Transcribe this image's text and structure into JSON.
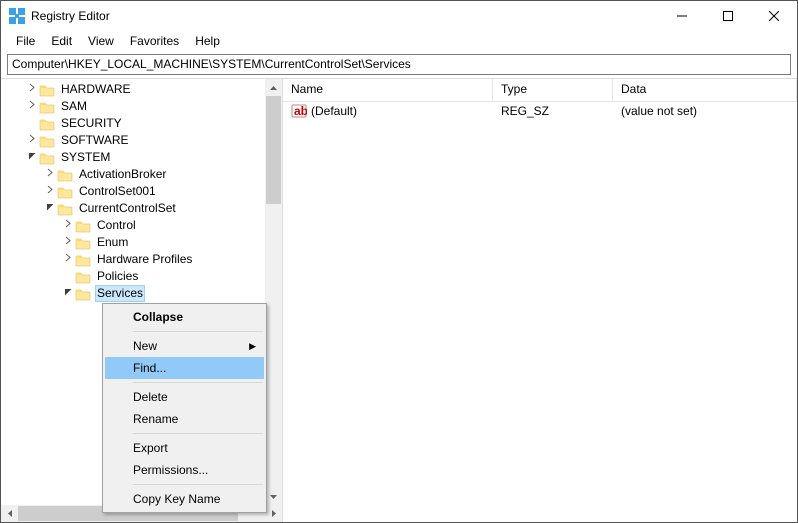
{
  "window": {
    "title": "Registry Editor"
  },
  "menu": {
    "file": "File",
    "edit": "Edit",
    "view": "View",
    "favorites": "Favorites",
    "help": "Help"
  },
  "address": "Computer\\HKEY_LOCAL_MACHINE\\SYSTEM\\CurrentControlSet\\Services",
  "tree": {
    "hardware": "HARDWARE",
    "sam": "SAM",
    "security": "SECURITY",
    "software": "SOFTWARE",
    "system": "SYSTEM",
    "activationbroker": "ActivationBroker",
    "controlset001": "ControlSet001",
    "currentcontrolset": "CurrentControlSet",
    "control": "Control",
    "enum": "Enum",
    "hwprofiles": "Hardware Profiles",
    "policies": "Policies",
    "services": "Services"
  },
  "list": {
    "columns": {
      "name": "Name",
      "type": "Type",
      "data": "Data"
    },
    "row": {
      "name": "(Default)",
      "type": "REG_SZ",
      "data": "(value not set)"
    }
  },
  "ctx": {
    "collapse": "Collapse",
    "new": "New",
    "find": "Find...",
    "delete": "Delete",
    "rename": "Rename",
    "export": "Export",
    "permissions": "Permissions...",
    "copykey": "Copy Key Name"
  }
}
